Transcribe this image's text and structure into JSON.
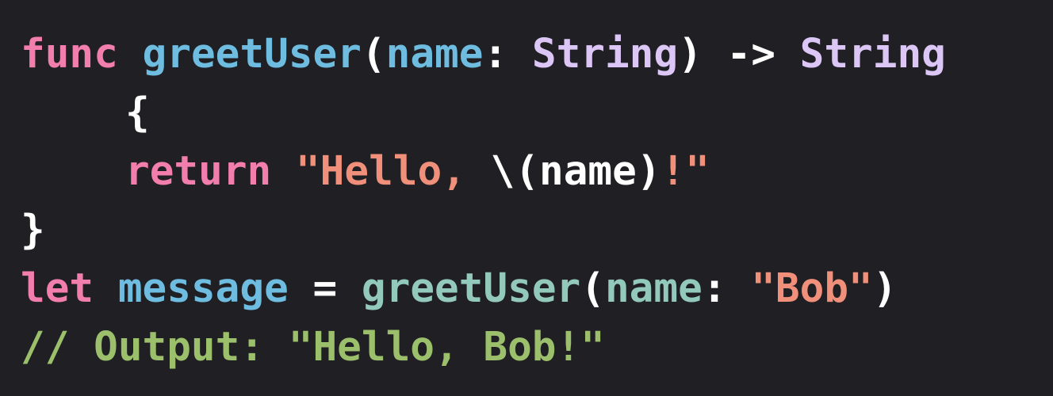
{
  "editor": {
    "theme": {
      "background": "#1f1f24",
      "keyword": "#fc5fa3",
      "function_name": "#6bdfff",
      "parameter": "#6bc7dd",
      "type": "#dabaff",
      "plain": "#ffffff",
      "string": "#fc6a5d",
      "call": "#9ad0c8",
      "comment": "#7f8c98"
    },
    "lines": [
      {
        "indent": false,
        "tokens": [
          {
            "text": "func",
            "color": "#f27ead"
          },
          {
            "text": " ",
            "color": "#ffffff"
          },
          {
            "text": "greetUser",
            "color": "#6ebde0"
          },
          {
            "text": "(",
            "color": "#ffffff"
          },
          {
            "text": "name",
            "color": "#6ebde0"
          },
          {
            "text": ": ",
            "color": "#ffffff"
          },
          {
            "text": "String",
            "color": "#dcc6f6"
          },
          {
            "text": ") -> ",
            "color": "#ffffff"
          },
          {
            "text": "String",
            "color": "#dcc6f6"
          }
        ]
      },
      {
        "indent": true,
        "tokens": [
          {
            "text": "{",
            "color": "#ffffff"
          }
        ]
      },
      {
        "indent": true,
        "tokens": [
          {
            "text": "return",
            "color": "#f27ead"
          },
          {
            "text": " ",
            "color": "#ffffff"
          },
          {
            "text": "\"Hello, ",
            "color": "#f0907a"
          },
          {
            "text": "\\(name)",
            "color": "#ffffff"
          },
          {
            "text": "!\"",
            "color": "#f0907a"
          }
        ]
      },
      {
        "indent": false,
        "tokens": [
          {
            "text": "}",
            "color": "#ffffff"
          }
        ]
      },
      {
        "indent": false,
        "tokens": [
          {
            "text": "let",
            "color": "#f27ead"
          },
          {
            "text": " ",
            "color": "#ffffff"
          },
          {
            "text": "message",
            "color": "#6ebde0"
          },
          {
            "text": " = ",
            "color": "#ffffff"
          },
          {
            "text": "greetUser",
            "color": "#93c9bc"
          },
          {
            "text": "(",
            "color": "#ffffff"
          },
          {
            "text": "name",
            "color": "#93c9bc"
          },
          {
            "text": ": ",
            "color": "#ffffff"
          },
          {
            "text": "\"Bob\"",
            "color": "#f0907a"
          },
          {
            "text": ")",
            "color": "#ffffff"
          }
        ]
      },
      {
        "indent": false,
        "tokens": [
          {
            "text": "// Output: \"Hello, Bob!\"",
            "color": "#9cbf6b"
          }
        ]
      }
    ]
  }
}
